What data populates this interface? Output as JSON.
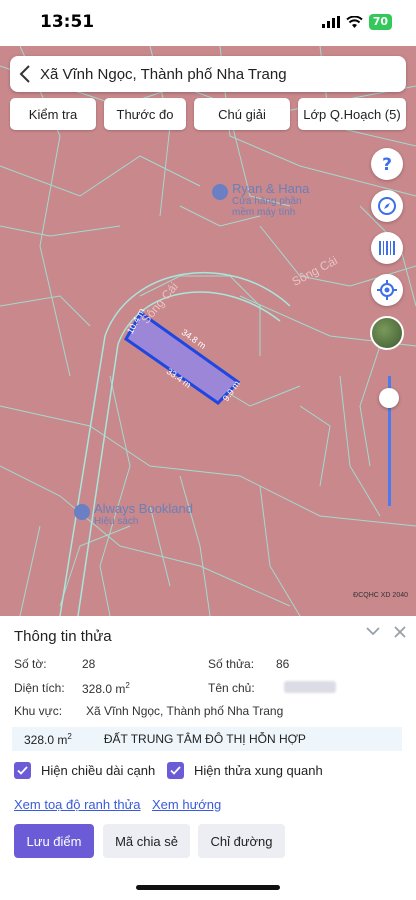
{
  "status_bar": {
    "time": "13:51",
    "battery": "70"
  },
  "search": {
    "text": "Xã Vĩnh Ngọc, Thành phố Nha Trang"
  },
  "toolbar": {
    "check": "Kiểm tra",
    "measure": "Thước đo",
    "legend": "Chú giải",
    "layer": "Lớp Q.Hoạch (5)"
  },
  "map": {
    "street_label_1": "Sông Cái",
    "street_label_2": "Sông Cái",
    "poi_1_name": "Ryan & Hana",
    "poi_1_sub1": "Cửa hàng phần",
    "poi_1_sub2": "mềm máy tính",
    "poi_2_name": "Always Bookland",
    "poi_2_sub": "Hiệu sách",
    "credit": "ĐCQHC XD 2040",
    "parcel_edges": [
      "10.4 m",
      "34.8 m",
      "33.4 m",
      "9.9 m"
    ]
  },
  "panel": {
    "title": "Thông tin thửa",
    "so_to_label": "Số tờ:",
    "so_to_value": "28",
    "so_thua_label": "Số thửa:",
    "so_thua_value": "86",
    "dien_tich_label": "Diện tích:",
    "dien_tich_value": "328.0 m",
    "dien_tich_sup": "2",
    "ten_chu_label": "Tên chủ:",
    "khu_vuc_label": "Khu vực:",
    "khu_vuc_value": "Xã Vĩnh Ngọc, Thành phố Nha Trang",
    "area_value": "328.0 m",
    "area_sup": "2",
    "land_type": "ĐẤT TRUNG TÂM ĐÔ THỊ HỖN HỢP",
    "check_1": "Hiện chiều dài cạnh",
    "check_2": "Hiện thửa xung quanh",
    "link_1": "Xem toạ độ ranh thửa",
    "link_2": "Xem hướng",
    "btn_save": "Lưu điểm",
    "btn_share": "Mã chia sẻ",
    "btn_route": "Chỉ đường"
  },
  "colors": {
    "map_fill": "#c8888c",
    "parcel_lines": "#9fe3d6",
    "selected_parcel": "#9b86d8",
    "accent": "#6b5bd6",
    "link": "#3a5bd9"
  }
}
